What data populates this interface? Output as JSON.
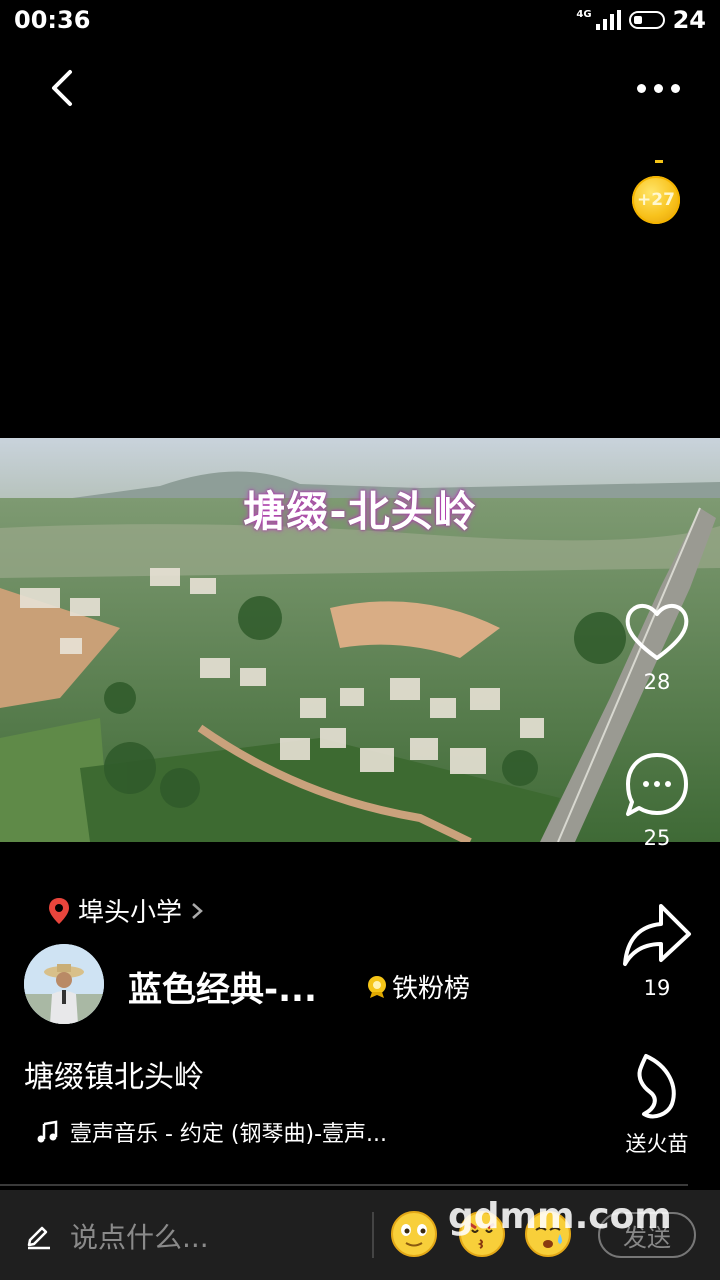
{
  "status_bar": {
    "time": "00:36",
    "network": "4G",
    "battery": "24"
  },
  "video": {
    "title_overlay": "塘缀-北头岭"
  },
  "coin": {
    "label": "+27"
  },
  "actions": {
    "like_count": "28",
    "comment_count": "25",
    "share_count": "19",
    "gift_label": "送火苗"
  },
  "post": {
    "location": "埠头小学",
    "author": "蓝色经典-...",
    "fan_rank": "铁粉榜",
    "caption": "塘缀镇北头岭",
    "music": "壹声音乐 - 约定 (钢琴曲)-壹声..."
  },
  "comment_bar": {
    "placeholder": "说点什么...",
    "send_label": "发送"
  },
  "watermark": "gdmm.com",
  "colors": {
    "coin": "#f8c21c",
    "location_pin": "#e8453c",
    "background": "#000000"
  }
}
